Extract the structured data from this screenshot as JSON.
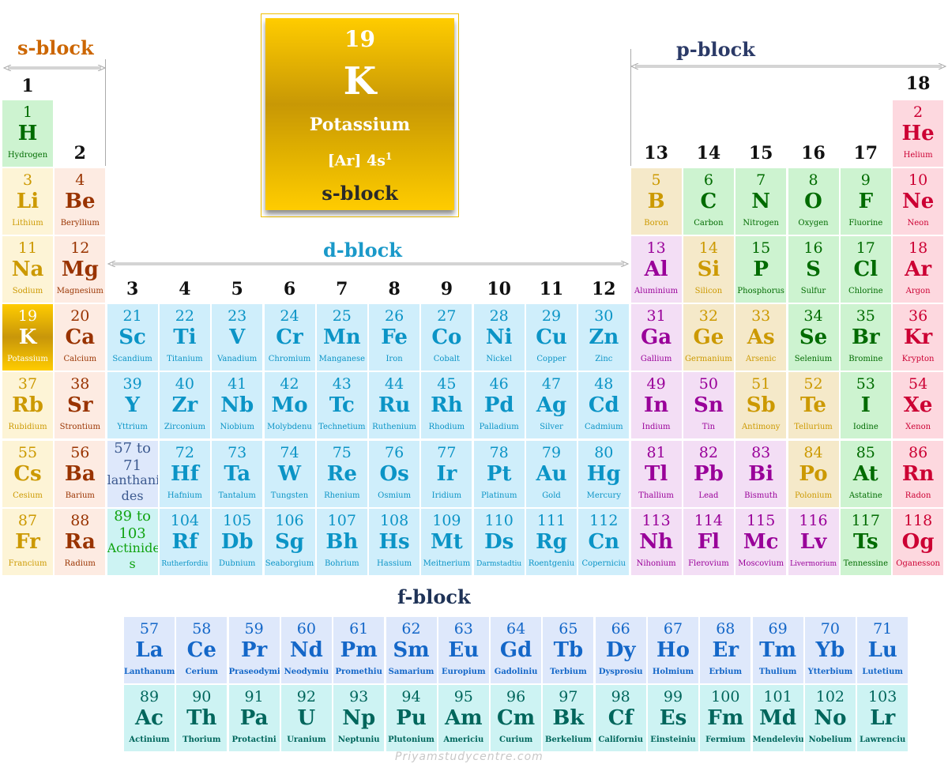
{
  "featured": {
    "number": "19",
    "symbol": "K",
    "name": "Potassium",
    "config_base": "[Ar] 4s",
    "config_sup": "1",
    "block": "s-block"
  },
  "block_labels": {
    "s": "s-block",
    "p": "p-block",
    "d": "d-block",
    "f": "f-block"
  },
  "colors": {
    "s_label": "#cc6600",
    "p_label": "#2b3a67",
    "d_label": "#1a99c9",
    "f_label": "#1f3357"
  },
  "groups": [
    "1",
    "2",
    "3",
    "4",
    "5",
    "6",
    "7",
    "8",
    "9",
    "10",
    "11",
    "12",
    "13",
    "14",
    "15",
    "16",
    "17",
    "18"
  ],
  "elements": [
    {
      "n": "1",
      "s": "H",
      "name": "Hydrogen",
      "c": "nonmetal",
      "col": 1,
      "row": 1
    },
    {
      "n": "2",
      "s": "He",
      "name": "Helium",
      "c": "noble",
      "col": 18,
      "row": 1
    },
    {
      "n": "3",
      "s": "Li",
      "name": "Lithium",
      "c": "alkali",
      "col": 1,
      "row": 2
    },
    {
      "n": "4",
      "s": "Be",
      "name": "Beryllium",
      "c": "alkaline",
      "col": 2,
      "row": 2
    },
    {
      "n": "5",
      "s": "B",
      "name": "Boron",
      "c": "metalloid",
      "col": 13,
      "row": 2
    },
    {
      "n": "6",
      "s": "C",
      "name": "Carbon",
      "c": "nonmetal",
      "col": 14,
      "row": 2
    },
    {
      "n": "7",
      "s": "N",
      "name": "Nitrogen",
      "c": "nonmetal",
      "col": 15,
      "row": 2
    },
    {
      "n": "8",
      "s": "O",
      "name": "Oxygen",
      "c": "nonmetal",
      "col": 16,
      "row": 2
    },
    {
      "n": "9",
      "s": "F",
      "name": "Fluorine",
      "c": "nonmetal",
      "col": 17,
      "row": 2
    },
    {
      "n": "10",
      "s": "Ne",
      "name": "Neon",
      "c": "noble",
      "col": 18,
      "row": 2
    },
    {
      "n": "11",
      "s": "Na",
      "name": "Sodium",
      "c": "alkali",
      "col": 1,
      "row": 3
    },
    {
      "n": "12",
      "s": "Mg",
      "name": "Magnesium",
      "c": "alkaline",
      "col": 2,
      "row": 3
    },
    {
      "n": "13",
      "s": "Al",
      "name": "Aluminium",
      "c": "post",
      "col": 13,
      "row": 3
    },
    {
      "n": "14",
      "s": "Si",
      "name": "Silicon",
      "c": "metalloid",
      "col": 14,
      "row": 3
    },
    {
      "n": "15",
      "s": "P",
      "name": "Phosphorus",
      "c": "nonmetal",
      "col": 15,
      "row": 3
    },
    {
      "n": "16",
      "s": "S",
      "name": "Sulfur",
      "c": "nonmetal",
      "col": 16,
      "row": 3
    },
    {
      "n": "17",
      "s": "Cl",
      "name": "Chlorine",
      "c": "nonmetal",
      "col": 17,
      "row": 3
    },
    {
      "n": "18",
      "s": "Ar",
      "name": "Argon",
      "c": "noble",
      "col": 18,
      "row": 3
    },
    {
      "n": "19",
      "s": "K",
      "name": "Potassium",
      "c": "potassium",
      "col": 1,
      "row": 4
    },
    {
      "n": "20",
      "s": "Ca",
      "name": "Calcium",
      "c": "alkaline",
      "col": 2,
      "row": 4
    },
    {
      "n": "21",
      "s": "Sc",
      "name": "Scandium",
      "c": "transition",
      "col": 3,
      "row": 4
    },
    {
      "n": "22",
      "s": "Ti",
      "name": "Titanium",
      "c": "transition",
      "col": 4,
      "row": 4
    },
    {
      "n": "23",
      "s": "V",
      "name": "Vanadium",
      "c": "transition",
      "col": 5,
      "row": 4
    },
    {
      "n": "24",
      "s": "Cr",
      "name": "Chromium",
      "c": "transition",
      "col": 6,
      "row": 4
    },
    {
      "n": "25",
      "s": "Mn",
      "name": "Manganese",
      "c": "transition",
      "col": 7,
      "row": 4
    },
    {
      "n": "26",
      "s": "Fe",
      "name": "Iron",
      "c": "transition",
      "col": 8,
      "row": 4
    },
    {
      "n": "27",
      "s": "Co",
      "name": "Cobalt",
      "c": "transition",
      "col": 9,
      "row": 4
    },
    {
      "n": "28",
      "s": "Ni",
      "name": "Nickel",
      "c": "transition",
      "col": 10,
      "row": 4
    },
    {
      "n": "29",
      "s": "Cu",
      "name": "Copper",
      "c": "transition",
      "col": 11,
      "row": 4
    },
    {
      "n": "30",
      "s": "Zn",
      "name": "Zinc",
      "c": "transition",
      "col": 12,
      "row": 4
    },
    {
      "n": "31",
      "s": "Ga",
      "name": "Gallium",
      "c": "post",
      "col": 13,
      "row": 4
    },
    {
      "n": "32",
      "s": "Ge",
      "name": "Germanium",
      "c": "metalloid",
      "col": 14,
      "row": 4
    },
    {
      "n": "33",
      "s": "As",
      "name": "Arsenic",
      "c": "metalloid",
      "col": 15,
      "row": 4
    },
    {
      "n": "34",
      "s": "Se",
      "name": "Selenium",
      "c": "nonmetal",
      "col": 16,
      "row": 4
    },
    {
      "n": "35",
      "s": "Br",
      "name": "Bromine",
      "c": "nonmetal",
      "col": 17,
      "row": 4
    },
    {
      "n": "36",
      "s": "Kr",
      "name": "Krypton",
      "c": "noble",
      "col": 18,
      "row": 4
    },
    {
      "n": "37",
      "s": "Rb",
      "name": "Rubidium",
      "c": "alkali",
      "col": 1,
      "row": 5
    },
    {
      "n": "38",
      "s": "Sr",
      "name": "Strontium",
      "c": "alkaline",
      "col": 2,
      "row": 5
    },
    {
      "n": "39",
      "s": "Y",
      "name": "Yttrium",
      "c": "transition",
      "col": 3,
      "row": 5
    },
    {
      "n": "40",
      "s": "Zr",
      "name": "Zirconium",
      "c": "transition",
      "col": 4,
      "row": 5
    },
    {
      "n": "41",
      "s": "Nb",
      "name": "Niobium",
      "c": "transition",
      "col": 5,
      "row": 5
    },
    {
      "n": "42",
      "s": "Mo",
      "name": "Molybdenu",
      "c": "transition",
      "col": 6,
      "row": 5
    },
    {
      "n": "43",
      "s": "Tc",
      "name": "Technetium",
      "c": "transition",
      "col": 7,
      "row": 5
    },
    {
      "n": "44",
      "s": "Ru",
      "name": "Ruthenium",
      "c": "transition",
      "col": 8,
      "row": 5
    },
    {
      "n": "45",
      "s": "Rh",
      "name": "Rhodium",
      "c": "transition",
      "col": 9,
      "row": 5
    },
    {
      "n": "46",
      "s": "Pd",
      "name": "Palladium",
      "c": "transition",
      "col": 10,
      "row": 5
    },
    {
      "n": "47",
      "s": "Ag",
      "name": "Silver",
      "c": "transition",
      "col": 11,
      "row": 5
    },
    {
      "n": "48",
      "s": "Cd",
      "name": "Cadmium",
      "c": "transition",
      "col": 12,
      "row": 5
    },
    {
      "n": "49",
      "s": "In",
      "name": "Indium",
      "c": "post",
      "col": 13,
      "row": 5
    },
    {
      "n": "50",
      "s": "Sn",
      "name": "Tin",
      "c": "post",
      "col": 14,
      "row": 5
    },
    {
      "n": "51",
      "s": "Sb",
      "name": "Antimony",
      "c": "metalloid",
      "col": 15,
      "row": 5
    },
    {
      "n": "52",
      "s": "Te",
      "name": "Tellurium",
      "c": "metalloid",
      "col": 16,
      "row": 5
    },
    {
      "n": "53",
      "s": "I",
      "name": "Iodine",
      "c": "nonmetal",
      "col": 17,
      "row": 5
    },
    {
      "n": "54",
      "s": "Xe",
      "name": "Xenon",
      "c": "noble",
      "col": 18,
      "row": 5
    },
    {
      "n": "55",
      "s": "Cs",
      "name": "Cesium",
      "c": "alkali",
      "col": 1,
      "row": 6
    },
    {
      "n": "56",
      "s": "Ba",
      "name": "Barium",
      "c": "alkaline",
      "col": 2,
      "row": 6
    },
    {
      "n": "72",
      "s": "Hf",
      "name": "Hafnium",
      "c": "transition",
      "col": 4,
      "row": 6
    },
    {
      "n": "73",
      "s": "Ta",
      "name": "Tantalum",
      "c": "transition",
      "col": 5,
      "row": 6
    },
    {
      "n": "74",
      "s": "W",
      "name": "Tungsten",
      "c": "transition",
      "col": 6,
      "row": 6
    },
    {
      "n": "75",
      "s": "Re",
      "name": "Rhenium",
      "c": "transition",
      "col": 7,
      "row": 6
    },
    {
      "n": "76",
      "s": "Os",
      "name": "Osmium",
      "c": "transition",
      "col": 8,
      "row": 6
    },
    {
      "n": "77",
      "s": "Ir",
      "name": "Iridium",
      "c": "transition",
      "col": 9,
      "row": 6
    },
    {
      "n": "78",
      "s": "Pt",
      "name": "Platinum",
      "c": "transition",
      "col": 10,
      "row": 6
    },
    {
      "n": "79",
      "s": "Au",
      "name": "Gold",
      "c": "transition",
      "col": 11,
      "row": 6
    },
    {
      "n": "80",
      "s": "Hg",
      "name": "Mercury",
      "c": "transition",
      "col": 12,
      "row": 6
    },
    {
      "n": "81",
      "s": "Tl",
      "name": "Thallium",
      "c": "post",
      "col": 13,
      "row": 6
    },
    {
      "n": "82",
      "s": "Pb",
      "name": "Lead",
      "c": "post",
      "col": 14,
      "row": 6
    },
    {
      "n": "83",
      "s": "Bi",
      "name": "Bismuth",
      "c": "post",
      "col": 15,
      "row": 6
    },
    {
      "n": "84",
      "s": "Po",
      "name": "Polonium",
      "c": "metalloid",
      "col": 16,
      "row": 6
    },
    {
      "n": "85",
      "s": "At",
      "name": "Astatine",
      "c": "nonmetal",
      "col": 17,
      "row": 6
    },
    {
      "n": "86",
      "s": "Rn",
      "name": "Radon",
      "c": "noble",
      "col": 18,
      "row": 6
    },
    {
      "n": "87",
      "s": "Fr",
      "name": "Francium",
      "c": "alkali",
      "col": 1,
      "row": 7
    },
    {
      "n": "88",
      "s": "Ra",
      "name": "Radium",
      "c": "alkaline",
      "col": 2,
      "row": 7
    },
    {
      "n": "104",
      "s": "Rf",
      "name": "Rutherfordiu",
      "c": "transition",
      "col": 4,
      "row": 7
    },
    {
      "n": "105",
      "s": "Db",
      "name": "Dubnium",
      "c": "transition",
      "col": 5,
      "row": 7
    },
    {
      "n": "106",
      "s": "Sg",
      "name": "Seaborgium",
      "c": "transition",
      "col": 6,
      "row": 7
    },
    {
      "n": "107",
      "s": "Bh",
      "name": "Bohrium",
      "c": "transition",
      "col": 7,
      "row": 7
    },
    {
      "n": "108",
      "s": "Hs",
      "name": "Hassium",
      "c": "transition",
      "col": 8,
      "row": 7
    },
    {
      "n": "109",
      "s": "Mt",
      "name": "Meitnerium",
      "c": "transition",
      "col": 9,
      "row": 7
    },
    {
      "n": "110",
      "s": "Ds",
      "name": "Darmstadtiu",
      "c": "transition",
      "col": 10,
      "row": 7
    },
    {
      "n": "111",
      "s": "Rg",
      "name": "Roentgeniu",
      "c": "transition",
      "col": 11,
      "row": 7
    },
    {
      "n": "112",
      "s": "Cn",
      "name": "Coperniciu",
      "c": "transition",
      "col": 12,
      "row": 7
    },
    {
      "n": "113",
      "s": "Nh",
      "name": "Nihonium",
      "c": "post",
      "col": 13,
      "row": 7
    },
    {
      "n": "114",
      "s": "Fl",
      "name": "Flerovium",
      "c": "post",
      "col": 14,
      "row": 7
    },
    {
      "n": "115",
      "s": "Mc",
      "name": "Moscovium",
      "c": "post",
      "col": 15,
      "row": 7
    },
    {
      "n": "116",
      "s": "Lv",
      "name": "Livermorium",
      "c": "post",
      "col": 16,
      "row": 7
    },
    {
      "n": "117",
      "s": "Ts",
      "name": "Tennessine",
      "c": "nonmetal",
      "col": 17,
      "row": 7
    },
    {
      "n": "118",
      "s": "Og",
      "name": "Oganesson",
      "c": "noble",
      "col": 18,
      "row": 7
    }
  ],
  "placeholders": [
    {
      "lines": [
        "57 to",
        "71",
        "lanthani",
        "des"
      ],
      "c": "lanth-ref",
      "col": 3,
      "row": 6
    },
    {
      "lines": [
        "89 to",
        "103",
        "Actinide",
        "s"
      ],
      "c": "act-ref",
      "col": 3,
      "row": 7
    }
  ],
  "lanthanides": [
    {
      "n": "57",
      "s": "La",
      "name": "Lanthanum"
    },
    {
      "n": "58",
      "s": "Ce",
      "name": "Cerium"
    },
    {
      "n": "59",
      "s": "Pr",
      "name": "Praseodymi"
    },
    {
      "n": "60",
      "s": "Nd",
      "name": "Neodymiu"
    },
    {
      "n": "61",
      "s": "Pm",
      "name": "Promethiu"
    },
    {
      "n": "62",
      "s": "Sm",
      "name": "Samarium"
    },
    {
      "n": "63",
      "s": "Eu",
      "name": "Europium"
    },
    {
      "n": "64",
      "s": "Gd",
      "name": "Gadoliniu"
    },
    {
      "n": "65",
      "s": "Tb",
      "name": "Terbium"
    },
    {
      "n": "66",
      "s": "Dy",
      "name": "Dysprosiu"
    },
    {
      "n": "67",
      "s": "Ho",
      "name": "Holmium"
    },
    {
      "n": "68",
      "s": "Er",
      "name": "Erbium"
    },
    {
      "n": "69",
      "s": "Tm",
      "name": "Thulium"
    },
    {
      "n": "70",
      "s": "Yb",
      "name": "Ytterbium"
    },
    {
      "n": "71",
      "s": "Lu",
      "name": "Lutetium"
    }
  ],
  "actinides": [
    {
      "n": "89",
      "s": "Ac",
      "name": "Actinium"
    },
    {
      "n": "90",
      "s": "Th",
      "name": "Thorium"
    },
    {
      "n": "91",
      "s": "Pa",
      "name": "Protactini"
    },
    {
      "n": "92",
      "s": "U",
      "name": "Uranium"
    },
    {
      "n": "93",
      "s": "Np",
      "name": "Neptuniu"
    },
    {
      "n": "94",
      "s": "Pu",
      "name": "Plutonium"
    },
    {
      "n": "95",
      "s": "Am",
      "name": "Americiu"
    },
    {
      "n": "96",
      "s": "Cm",
      "name": "Curium"
    },
    {
      "n": "97",
      "s": "Bk",
      "name": "Berkelium"
    },
    {
      "n": "98",
      "s": "Cf",
      "name": "Californiu"
    },
    {
      "n": "99",
      "s": "Es",
      "name": "Einsteiniu"
    },
    {
      "n": "100",
      "s": "Fm",
      "name": "Fermium"
    },
    {
      "n": "101",
      "s": "Md",
      "name": "Mendeleviu"
    },
    {
      "n": "102",
      "s": "No",
      "name": "Nobelium"
    },
    {
      "n": "103",
      "s": "Lr",
      "name": "Lawrenciu"
    }
  ],
  "watermark": "Priyamstudycentre.com"
}
